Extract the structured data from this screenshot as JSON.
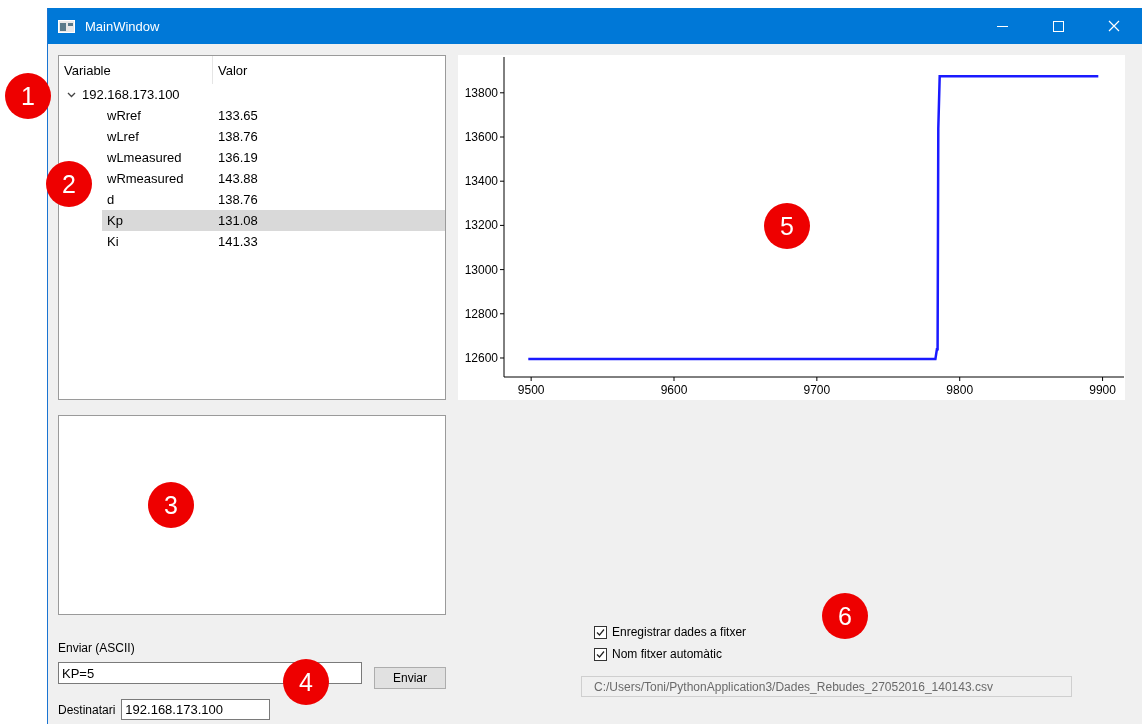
{
  "window": {
    "title": "MainWindow"
  },
  "tree": {
    "columns": [
      "Variable",
      "Valor"
    ],
    "items": [
      {
        "label": "192.168.173.100",
        "expanded": true,
        "children": [
          {
            "variable": "wRref",
            "value": "133.65",
            "selected": false
          },
          {
            "variable": "wLref",
            "value": "138.76",
            "selected": false
          },
          {
            "variable": "wLmeasured",
            "value": "136.19",
            "selected": false
          },
          {
            "variable": "wRmeasured",
            "value": "143.88",
            "selected": false
          },
          {
            "variable": "d",
            "value": "138.76",
            "selected": false
          },
          {
            "variable": "Kp",
            "value": "131.08",
            "selected": true
          },
          {
            "variable": "Ki",
            "value": "141.33",
            "selected": false
          }
        ]
      }
    ]
  },
  "chart": {
    "chart_data": {
      "type": "line",
      "x": [
        9498,
        9783,
        9784,
        9784.5,
        9785,
        9786,
        9897
      ],
      "series": [
        {
          "color": "#1a1aff",
          "values": [
            12595,
            12595,
            12640,
            12640,
            13640,
            13875,
            13875
          ]
        }
      ],
      "xlim": [
        9481,
        9915
      ],
      "ylim": [
        12514,
        13962
      ],
      "xticks": [
        9500,
        9600,
        9700,
        9800,
        9900
      ],
      "yticks": [
        12600,
        12800,
        13000,
        13200,
        13400,
        13600,
        13800
      ]
    }
  },
  "send": {
    "label": "Enviar (ASCII)",
    "value": "KP=5",
    "button": "Enviar",
    "recipient_label": "Destinatari",
    "recipient_value": "192.168.173.100"
  },
  "logging": {
    "options": [
      {
        "label": "Enregistrar dades a fitxer",
        "checked": true
      },
      {
        "label": "Nom fitxer automàtic",
        "checked": true
      }
    ],
    "path": {
      "value": "C:/Users/Toni/PythonApplication3/Dades_Rebudes_27052016_140143.csv",
      "disabled": true
    }
  },
  "annotations": [
    {
      "label": "1"
    },
    {
      "label": "2"
    },
    {
      "label": "3"
    },
    {
      "label": "4"
    },
    {
      "label": "5"
    },
    {
      "label": "6"
    }
  ]
}
